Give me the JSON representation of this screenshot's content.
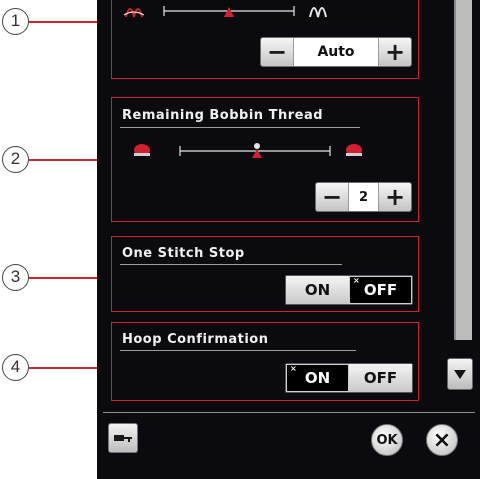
{
  "callouts": [
    "1",
    "2",
    "3",
    "4"
  ],
  "thread_tension": {
    "value": "Auto",
    "minus": "−",
    "plus": "+"
  },
  "bobbin": {
    "title": "Remaining Bobbin Thread",
    "value": "2",
    "minus": "−",
    "plus": "+"
  },
  "one_stitch_stop": {
    "title": "One Stitch Stop",
    "on_label": "ON",
    "off_label": "OFF",
    "selected": "OFF",
    "mark": "×"
  },
  "hoop_confirmation": {
    "title": "Hoop Confirmation",
    "on_label": "ON",
    "off_label": "OFF",
    "selected": "ON",
    "mark": "×"
  },
  "footer": {
    "ok_label": "OK",
    "close_label": "×"
  },
  "icons": [
    "thread-tension-icon",
    "bobbin-icon",
    "scroll-down-arrow-icon",
    "key-icon",
    "close-icon"
  ],
  "colors": {
    "panel": "#0b0b0f",
    "accent_red": "#cf2030",
    "scrollbar": "#bcbcbc"
  }
}
